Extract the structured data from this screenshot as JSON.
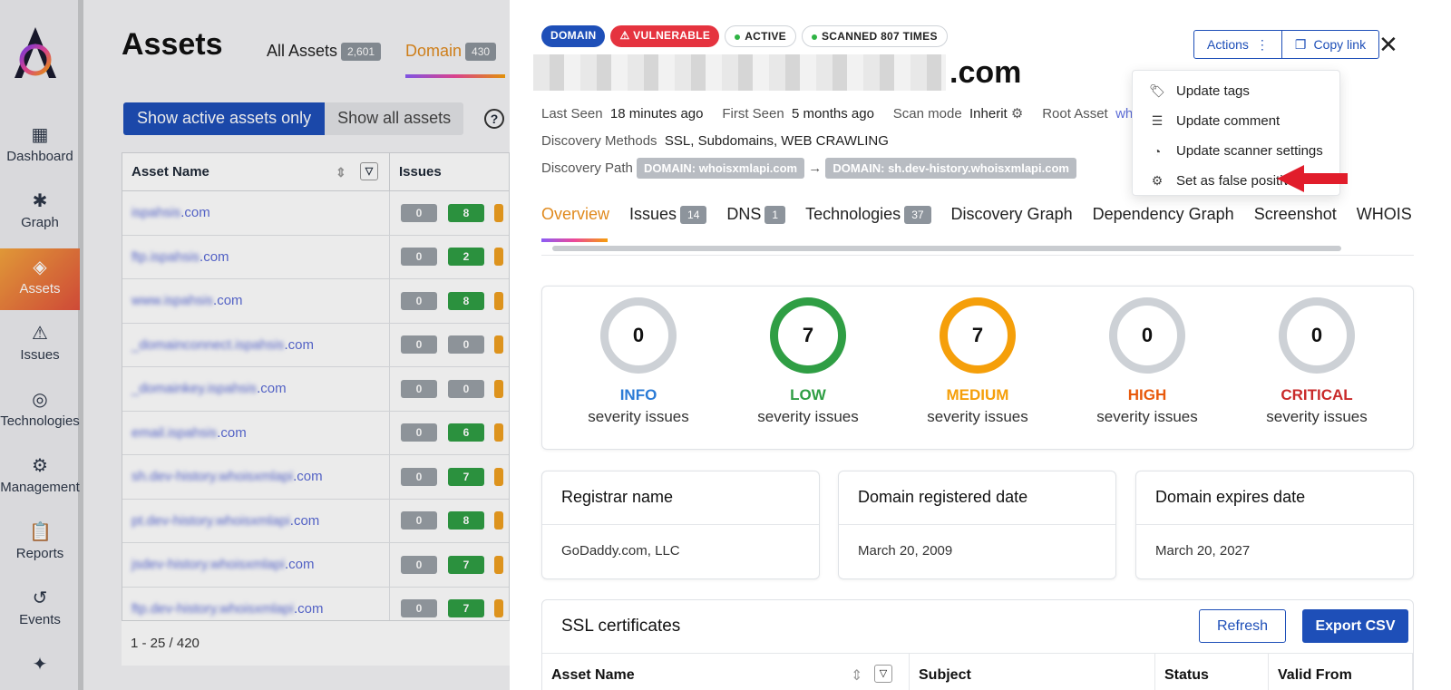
{
  "sidebar": {
    "items": [
      {
        "label": "Dashboard",
        "icon": "dashboard-icon"
      },
      {
        "label": "Graph",
        "icon": "graph-icon"
      },
      {
        "label": "Assets",
        "icon": "layers-icon"
      },
      {
        "label": "Issues",
        "icon": "warning-icon"
      },
      {
        "label": "Technologies",
        "icon": "fingerprint-icon"
      },
      {
        "label": "Management",
        "icon": "gear-icon"
      },
      {
        "label": "Reports",
        "icon": "clipboard-icon"
      },
      {
        "label": "Events",
        "icon": "history-icon"
      },
      {
        "label": "",
        "icon": "puzzle-icon"
      }
    ],
    "active_color": "#e0503c"
  },
  "assets_page": {
    "title": "Assets",
    "tab_all": "All Assets",
    "tab_all_count": "2,601",
    "tab_domain": "Domain",
    "tab_domain_count": "430",
    "toggle_active": "Show active assets only",
    "toggle_all": "Show all assets",
    "col_asset_name": "Asset Name",
    "col_issues": "Issues",
    "rows": [
      {
        "prefix": "ispahsis",
        "suffix": ".com",
        "a": "0",
        "b": "8"
      },
      {
        "prefix": "ftp.ispahsis",
        "suffix": ".com",
        "a": "0",
        "b": "2"
      },
      {
        "prefix": "www.ispahsis",
        "suffix": ".com",
        "a": "0",
        "b": "8"
      },
      {
        "prefix": "_domainconnect.ispahsis",
        "suffix": ".com",
        "a": "0",
        "b": "0"
      },
      {
        "prefix": "_domainkey.ispahsis",
        "suffix": ".com",
        "a": "0",
        "b": "0"
      },
      {
        "prefix": "email.ispahsis",
        "suffix": ".com",
        "a": "0",
        "b": "6"
      },
      {
        "prefix": "sh.dev-history.whoisxmlapi",
        "suffix": ".com",
        "a": "0",
        "b": "7"
      },
      {
        "prefix": "pt.dev-history.whoisxmlapi",
        "suffix": ".com",
        "a": "0",
        "b": "8"
      },
      {
        "prefix": "jsdev-history.whoisxmlapi",
        "suffix": ".com",
        "a": "0",
        "b": "7"
      },
      {
        "prefix": "ftp.dev-history.whoisxmlapi",
        "suffix": ".com",
        "a": "0",
        "b": "7"
      }
    ],
    "pagination": "1 - 25 / 420"
  },
  "drawer": {
    "tags": {
      "domain": "DOMAIN",
      "vulnerable": "VULNERABLE",
      "active": "ACTIVE",
      "scanned": "SCANNED 807 TIMES"
    },
    "title_suffix": ".com",
    "last_seen_label": "Last Seen",
    "last_seen_value": "18 minutes ago",
    "first_seen_label": "First Seen",
    "first_seen_value": "5 months ago",
    "scan_mode_label": "Scan mode",
    "scan_mode_value": "Inherit",
    "root_asset_label": "Root Asset",
    "root_asset_value": "wh",
    "discovery_methods_label": "Discovery Methods",
    "discovery_methods_value": "SSL, Subdomains, WEB CRAWLING",
    "discovery_path_label": "Discovery Path",
    "path_chip_1": "DOMAIN: whoisxmlapi.com",
    "path_chip_2": "DOMAIN: sh.dev-history.whoisxmlapi.com",
    "actions_label": "Actions",
    "copy_link_label": "Copy link",
    "menu": [
      {
        "label": "Update tags",
        "icon": "tag-icon"
      },
      {
        "label": "Update comment",
        "icon": "comment-icon"
      },
      {
        "label": "Update scanner settings",
        "icon": "scanner-icon"
      },
      {
        "label": "Set as false positive",
        "icon": "gear-icon"
      }
    ],
    "tabs": [
      {
        "label": "Overview",
        "count": ""
      },
      {
        "label": "Issues",
        "count": "14"
      },
      {
        "label": "DNS",
        "count": "1"
      },
      {
        "label": "Technologies",
        "count": "37"
      },
      {
        "label": "Discovery Graph",
        "count": ""
      },
      {
        "label": "Dependency Graph",
        "count": ""
      },
      {
        "label": "Screenshot",
        "count": ""
      },
      {
        "label": "WHOIS",
        "count": ""
      }
    ],
    "severity": [
      {
        "count": "0",
        "level": "INFO",
        "sub": "severity issues",
        "color": "#2b7bd6",
        "ring": "#cdd1d6"
      },
      {
        "count": "7",
        "level": "LOW",
        "sub": "severity issues",
        "color": "#2f9e44",
        "ring": "#2f9e44"
      },
      {
        "count": "7",
        "level": "MEDIUM",
        "sub": "severity issues",
        "color": "#f59f0a",
        "ring": "#f59f0a"
      },
      {
        "count": "0",
        "level": "HIGH",
        "sub": "severity issues",
        "color": "#e8590c",
        "ring": "#cdd1d6"
      },
      {
        "count": "0",
        "level": "CRITICAL",
        "sub": "severity issues",
        "color": "#c92a2a",
        "ring": "#cdd1d6"
      }
    ],
    "registrar_label": "Registrar name",
    "registrar_value": "GoDaddy.com, LLC",
    "registered_label": "Domain registered date",
    "registered_value": "March 20, 2009",
    "expires_label": "Domain expires date",
    "expires_value": "March 20, 2027",
    "ssl_title": "SSL certificates",
    "refresh_label": "Refresh",
    "export_label": "Export CSV",
    "ssl_cols": [
      "Asset Name",
      "Subject",
      "Status",
      "Valid From"
    ]
  }
}
